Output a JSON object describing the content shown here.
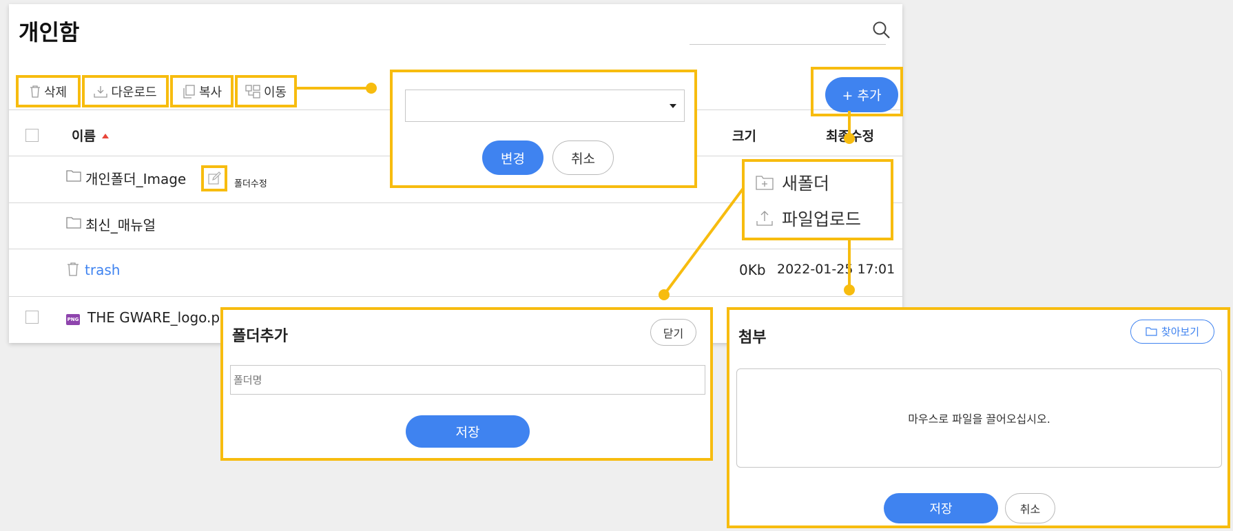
{
  "header": {
    "title": "개인함",
    "search_icon": "search-icon"
  },
  "toolbar": {
    "delete": "삭제",
    "download": "다운로드",
    "copy": "복사",
    "move": "이동",
    "add": "+ 추가"
  },
  "table": {
    "columns": {
      "name": "이름",
      "size": "크기",
      "modified": "최종수정"
    },
    "rows": [
      {
        "name": "개인폴더_Image",
        "edit_label": "폴더수정"
      },
      {
        "name": "최신_매뉴얼"
      },
      {
        "name": "trash",
        "size": "0Kb",
        "modified": "2022-01-25 17:01"
      },
      {
        "name": "THE GWARE_logo.pr",
        "file_badge": "PNG"
      }
    ]
  },
  "move_popup": {
    "select_value": "",
    "confirm": "변경",
    "cancel": "취소"
  },
  "add_menu": {
    "items": [
      {
        "label": "새폴더",
        "icon": "new-folder-icon"
      },
      {
        "label": "파일업로드",
        "icon": "upload-icon"
      }
    ]
  },
  "folder_dialog": {
    "title": "폴더추가",
    "close": "닫기",
    "placeholder": "폴더명",
    "save": "저장"
  },
  "attach_dialog": {
    "title": "첨부",
    "browse": "찾아보기",
    "drop_text": "마우스로 파일을 끌어오십시오.",
    "save": "저장",
    "cancel": "취소"
  },
  "colors": {
    "accent": "#3f83f0",
    "highlight": "#f7bc0f",
    "link": "#3f83f0"
  }
}
